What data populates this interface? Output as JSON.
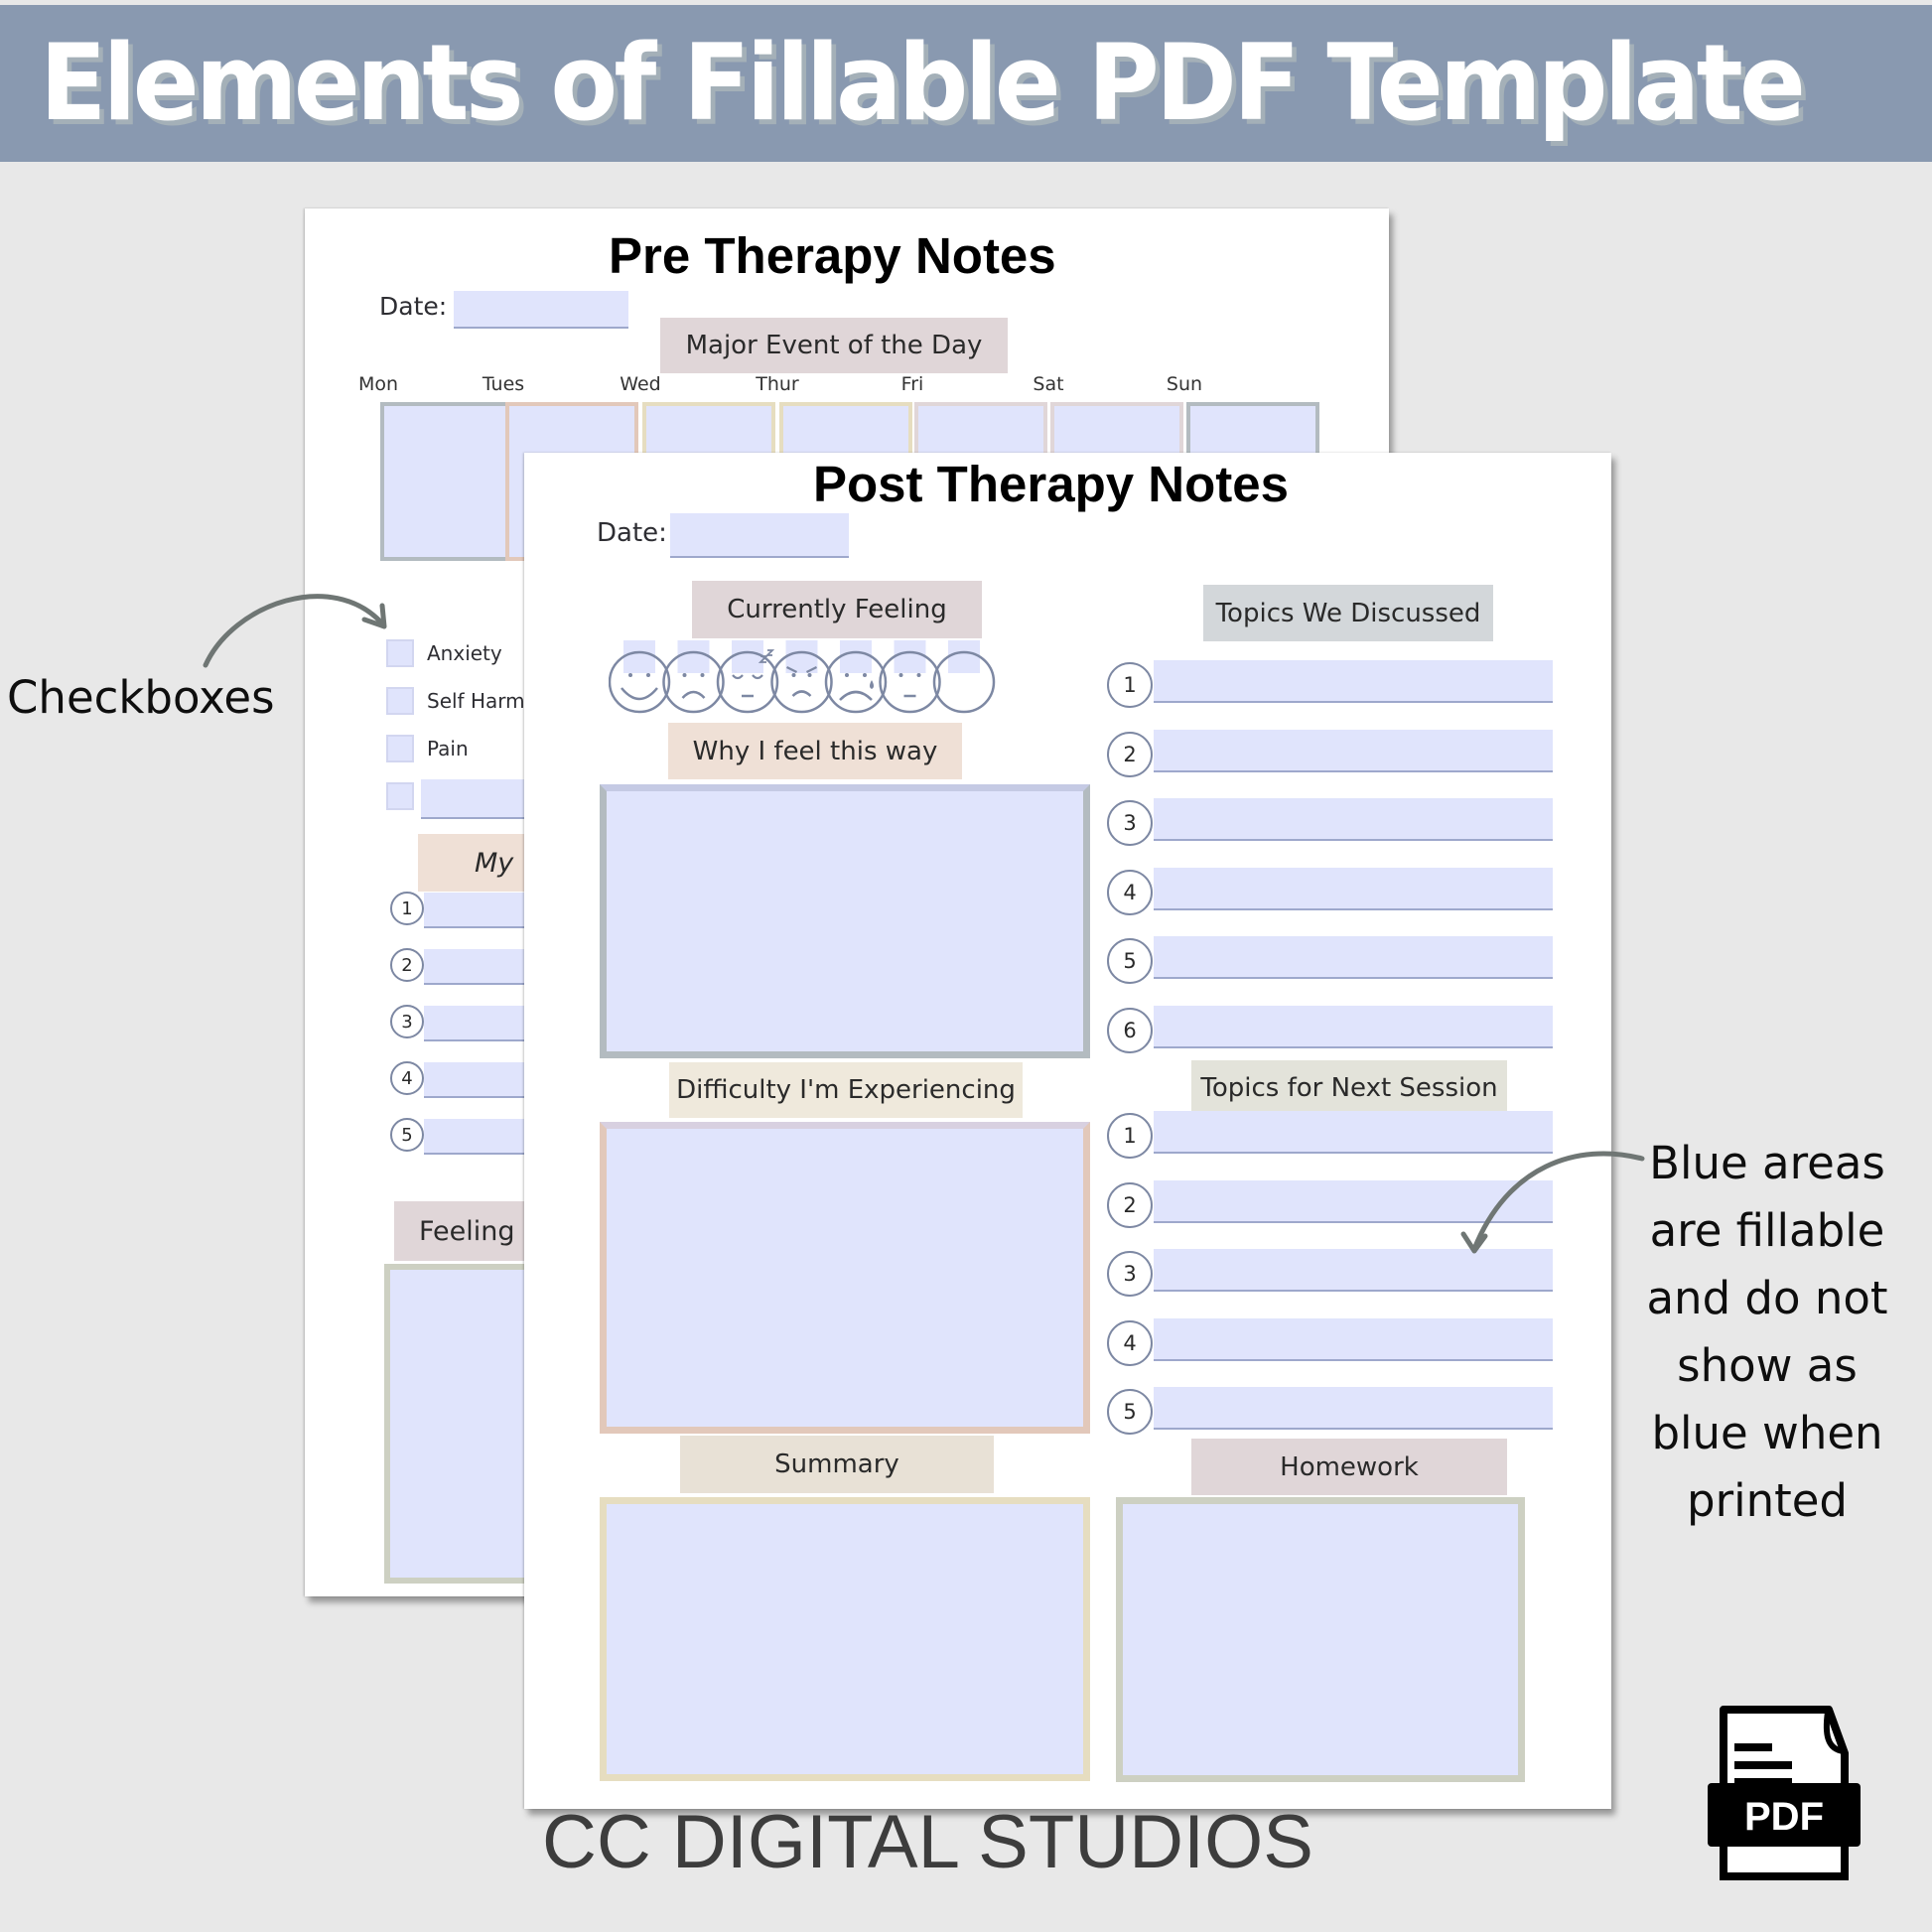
{
  "banner": {
    "title": "Elements of Fillable PDF Template"
  },
  "callouts": {
    "checkboxes": "Checkboxes",
    "blue_areas_lines": [
      "Blue areas",
      "are fillable",
      "and do not",
      "show as",
      "blue when",
      "printed"
    ]
  },
  "brand": {
    "name": "CC DIGITAL STUDIOS"
  },
  "pdf_icon": {
    "label": "PDF"
  },
  "pre_therapy": {
    "title": "Pre Therapy Notes",
    "date_label": "Date:",
    "date_value": "",
    "major_event_header": "Major Event of the Day",
    "days": [
      "Mon",
      "Tues",
      "Wed",
      "Thur",
      "Fri",
      "Sat",
      "Sun"
    ],
    "checkboxes": [
      {
        "label": "Anxiety",
        "checked": false
      },
      {
        "label": "Self Harm",
        "checked": false
      },
      {
        "label": "Pain",
        "checked": false
      },
      {
        "label": "",
        "checked": false
      }
    ],
    "my_header_partial": "My",
    "numbered_items": [
      "1",
      "2",
      "3",
      "4",
      "5"
    ],
    "feeling_header_partial": "Feeling"
  },
  "post_therapy": {
    "title": "Post Therapy Notes",
    "date_label": "Date:",
    "date_value": "",
    "currently_feeling_header": "Currently Feeling",
    "moods": [
      "happy",
      "sad",
      "sleepy",
      "angry",
      "crying",
      "neutral",
      "blank"
    ],
    "why_header": "Why I feel this way",
    "difficulty_header": "Difficulty I'm Experiencing",
    "topics_discussed_header": "Topics We Discussed",
    "topics_discussed_numbers": [
      "1",
      "2",
      "3",
      "4",
      "5",
      "6"
    ],
    "topics_next_header": "Topics for Next Session",
    "topics_next_numbers": [
      "1",
      "2",
      "3",
      "4",
      "5"
    ],
    "summary_header": "Summary",
    "homework_header": "Homework"
  },
  "colors": {
    "banner_bg": "#8999b0",
    "fillable_blue": "#e0e4fc",
    "header_mauve": "#e0d6d8",
    "header_peach": "#efe0d6",
    "header_grey": "#d3d7da",
    "header_cream": "#efe9dc",
    "header_sage": "#e3e3da"
  }
}
